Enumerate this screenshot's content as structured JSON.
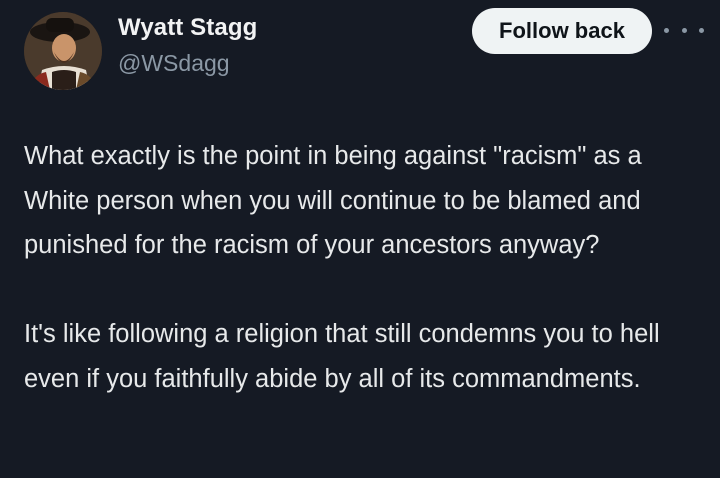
{
  "author": {
    "display_name": "Wyatt Stagg",
    "handle": "@WSdagg"
  },
  "actions": {
    "follow_label": "Follow back",
    "more_icon": "more-horizontal-icon"
  },
  "tweet": {
    "paragraphs": [
      "What exactly is the point in being against \"racism\" as a White person when you will continue to be blamed and punished for the racism of your ancestors anyway?",
      "It's like following a religion that still condemns you to hell even if you faithfully abide by all of its commandments."
    ]
  },
  "colors": {
    "background": "#151a24",
    "text": "#e7e9ea",
    "secondary_text": "#8b98a5",
    "button_bg": "#eff3f4",
    "button_text": "#0f1419"
  }
}
